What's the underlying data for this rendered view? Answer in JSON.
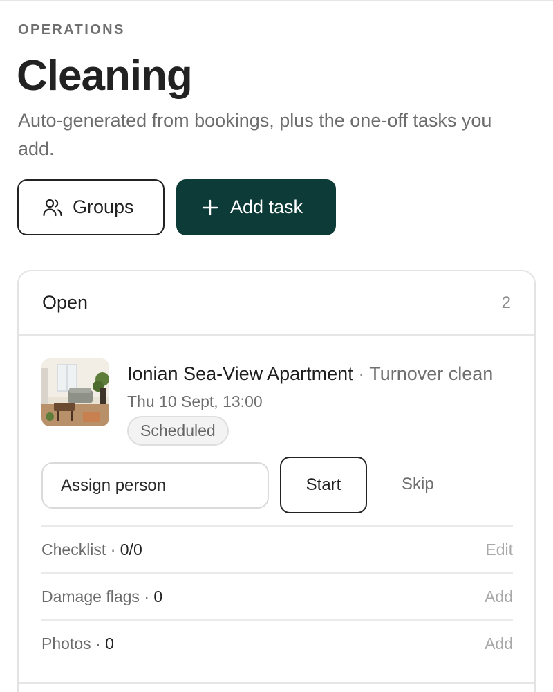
{
  "header": {
    "eyebrow": "OPERATIONS",
    "title": "Cleaning",
    "subtitle": "Auto-generated from bookings, plus the one-off tasks you add."
  },
  "actions": {
    "groups_label": "Groups",
    "groups_icon": "users-icon",
    "add_task_label": "Add task",
    "add_task_icon": "plus-icon"
  },
  "colors": {
    "primary": "#0d3b37",
    "muted_text": "#6f6f6f"
  },
  "open_card": {
    "title": "Open",
    "count": "2",
    "task": {
      "property": "Ionian Sea-View Apartment",
      "separator": "·",
      "type": "Turnover clean",
      "date": "Thu 10 Sept, 13:00",
      "status": "Scheduled",
      "assign_placeholder": "Assign person",
      "start_label": "Start",
      "skip_label": "Skip",
      "checklist": {
        "label": "Checklist",
        "value": "0/0",
        "action": "Edit"
      },
      "damage_flags": {
        "label": "Damage flags",
        "value": "0",
        "action": "Add"
      },
      "photos": {
        "label": "Photos",
        "value": "0",
        "action": "Add"
      }
    }
  }
}
